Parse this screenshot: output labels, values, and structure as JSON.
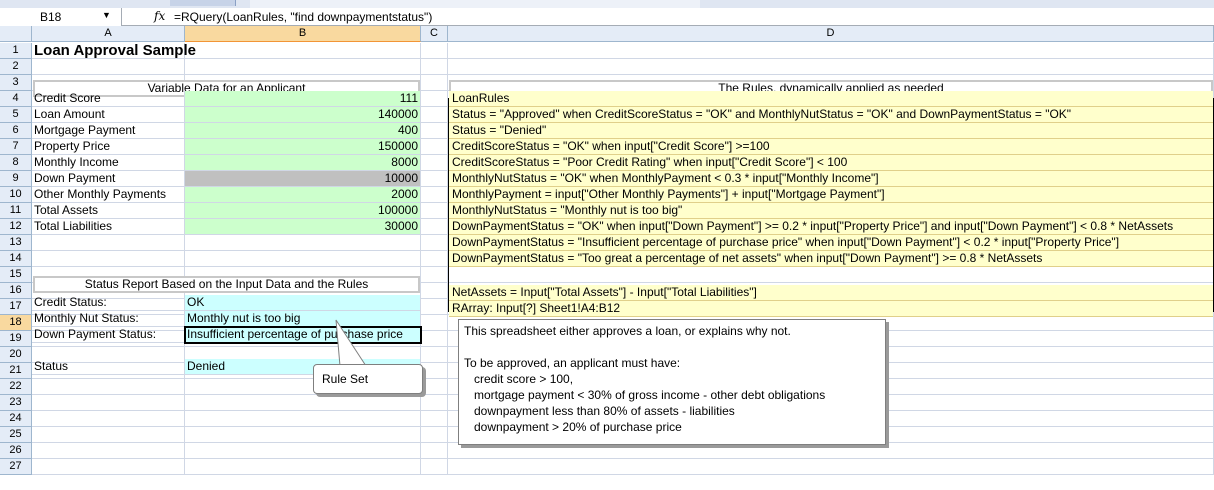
{
  "formula_bar": {
    "name_box": "B18",
    "fx_label": "fx",
    "formula": "=RQuery(LoanRules, \"find downpaymentstatus\")"
  },
  "columns": [
    "A",
    "B",
    "C",
    "D"
  ],
  "rows": [
    "1",
    "2",
    "3",
    "4",
    "5",
    "6",
    "7",
    "8",
    "9",
    "10",
    "11",
    "12",
    "13",
    "14",
    "15",
    "16",
    "17",
    "18",
    "19",
    "20",
    "21",
    "22",
    "23",
    "24",
    "25",
    "26",
    "27"
  ],
  "sheet": {
    "title": "Loan Approval Sample",
    "variables_header": "Variable Data for an Applicant",
    "variables": [
      {
        "label": "Credit Score",
        "value": "111"
      },
      {
        "label": "Loan Amount",
        "value": "140000"
      },
      {
        "label": "Mortgage Payment",
        "value": "400"
      },
      {
        "label": "Property Price",
        "value": "150000"
      },
      {
        "label": "Monthly Income",
        "value": "8000"
      },
      {
        "label": "Down Payment",
        "value": "10000"
      },
      {
        "label": "Other Monthly Payments",
        "value": "2000"
      },
      {
        "label": "Total Assets",
        "value": "100000"
      },
      {
        "label": "Total Liabilities",
        "value": "30000"
      }
    ],
    "status_header": "Status Report Based on the Input Data and the Rules",
    "status": [
      {
        "label": "Credit Status:",
        "value": "OK"
      },
      {
        "label": "Monthly Nut Status:",
        "value": "Monthly nut is too big"
      },
      {
        "label": "Down Payment Status:",
        "value": "Insufficient percentage of purchase price"
      }
    ],
    "final_status": {
      "label": "Status",
      "value": "Denied"
    },
    "rules_header": "The Rules, dynamically applied as needed",
    "rules": [
      "LoanRules",
      "Status = \"Approved\" when CreditScoreStatus = \"OK\" and MonthlyNutStatus = \"OK\" and DownPaymentStatus = \"OK\"",
      "Status = \"Denied\"",
      "CreditScoreStatus = \"OK\" when input[\"Credit Score\"] >=100",
      "CreditScoreStatus = \"Poor Credit Rating\"  when input[\"Credit Score\"] < 100",
      "MonthlyNutStatus = \"OK\" when MonthlyPayment < 0.3 * input[\"Monthly Income\"]",
      "MonthlyPayment = input[\"Other Monthly Payments\"] + input[\"Mortgage Payment\"]",
      "MonthlyNutStatus = \"Monthly nut is too big\"",
      "DownPaymentStatus = \"OK\" when input[\"Down Payment\"] >= 0.2 * input[\"Property Price\"] and input[\"Down Payment\"] < 0.8 * NetAssets",
      "DownPaymentStatus = \"Insufficient percentage of purchase price\" when input[\"Down Payment\"] < 0.2 * input[\"Property Price\"]",
      "DownPaymentStatus = \"Too great a percentage of net assets\" when input[\"Down Payment\"] >= 0.8 * NetAssets",
      "NetAssets = Input[\"Total Assets\"] - Input[\"Total Liabilities\"]",
      "RArray: Input[?]  Sheet1!A4:B12"
    ]
  },
  "note": {
    "lines": [
      "This spreadsheet either approves a loan, or explains why not.",
      "",
      "To be approved, an applicant must have:",
      "   credit score > 100,",
      "   mortgage payment < 30% of gross income - other debt obligations",
      "   downpayment less than 80% of assets - liabilities",
      "   downpayment > 20% of purchase price"
    ]
  },
  "callout": {
    "label": "Rule Set"
  },
  "colors": {
    "input_green": "#ccffcc",
    "status_cyan": "#ccffff",
    "rules_yellow": "#ffffcc",
    "highlight_gray": "#c0c0c0",
    "selected_header": "#f9d99f"
  }
}
